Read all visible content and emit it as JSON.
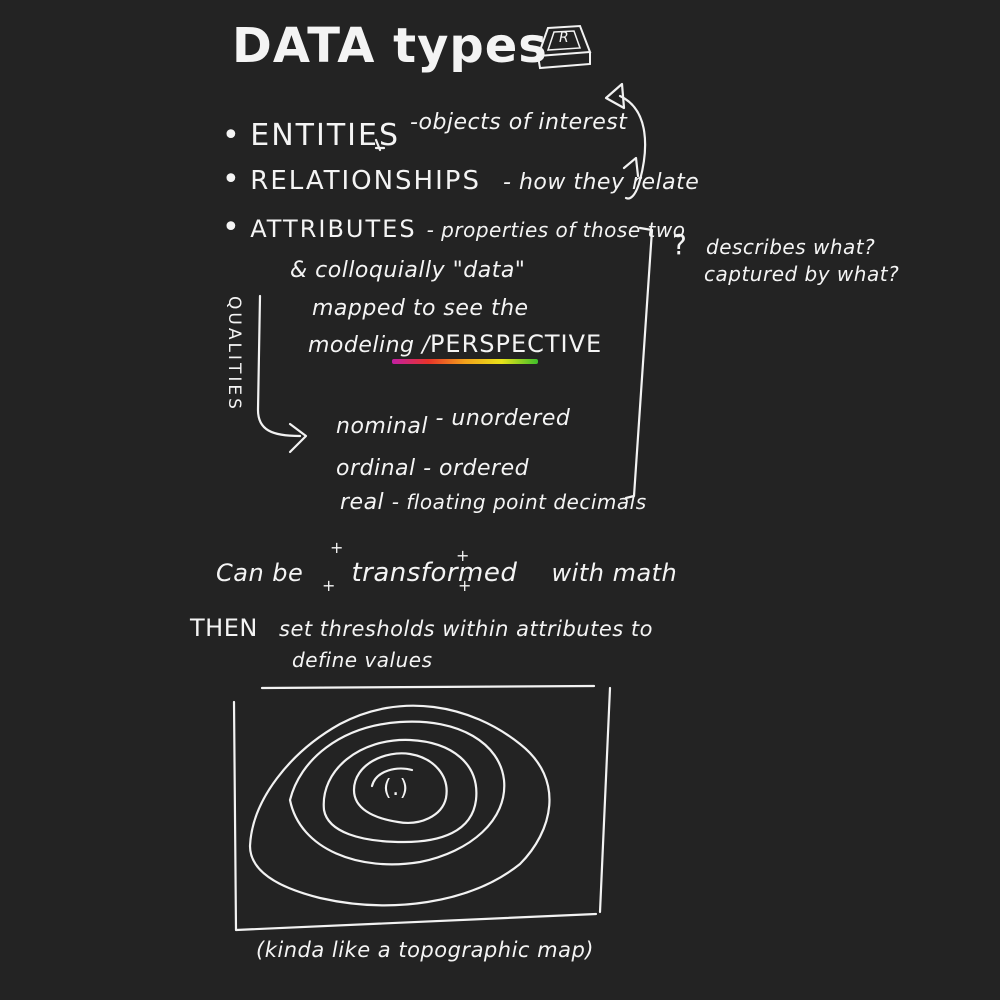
{
  "title": "DATA types",
  "key_icon": {
    "label": "R",
    "icon": "keyboard-key-icon"
  },
  "items": [
    {
      "term": "ENTITIES",
      "desc": "-objects of interest"
    },
    {
      "term": "RELATIONSHIPS",
      "desc": "- how they relate"
    },
    {
      "term": "ATTRIBUTES",
      "desc": "- properties of those two"
    }
  ],
  "aside": {
    "mark": "?",
    "line1": "describes what?",
    "line2": "captured by what?"
  },
  "note": {
    "line1": "& colloquially \"data\"",
    "line2": "mapped to see the",
    "line3_prefix": "modeling /",
    "line3_emph": "PERSPECTIVE"
  },
  "qualities_label": "QUALITIES",
  "qualities": [
    {
      "name": "nominal",
      "desc": "- unordered"
    },
    {
      "name": "ordinal",
      "desc": "- ordered"
    },
    {
      "name": "real",
      "desc": "- floating point decimals"
    }
  ],
  "transform": {
    "prefix": "Can be",
    "word": "transformed",
    "suffix": "with math"
  },
  "threshold": {
    "emph": "THEN",
    "line1": "set thresholds within attributes to",
    "line2": "define values"
  },
  "map_inner_label": "(.)",
  "map_caption": "(kinda like a topographic map)"
}
